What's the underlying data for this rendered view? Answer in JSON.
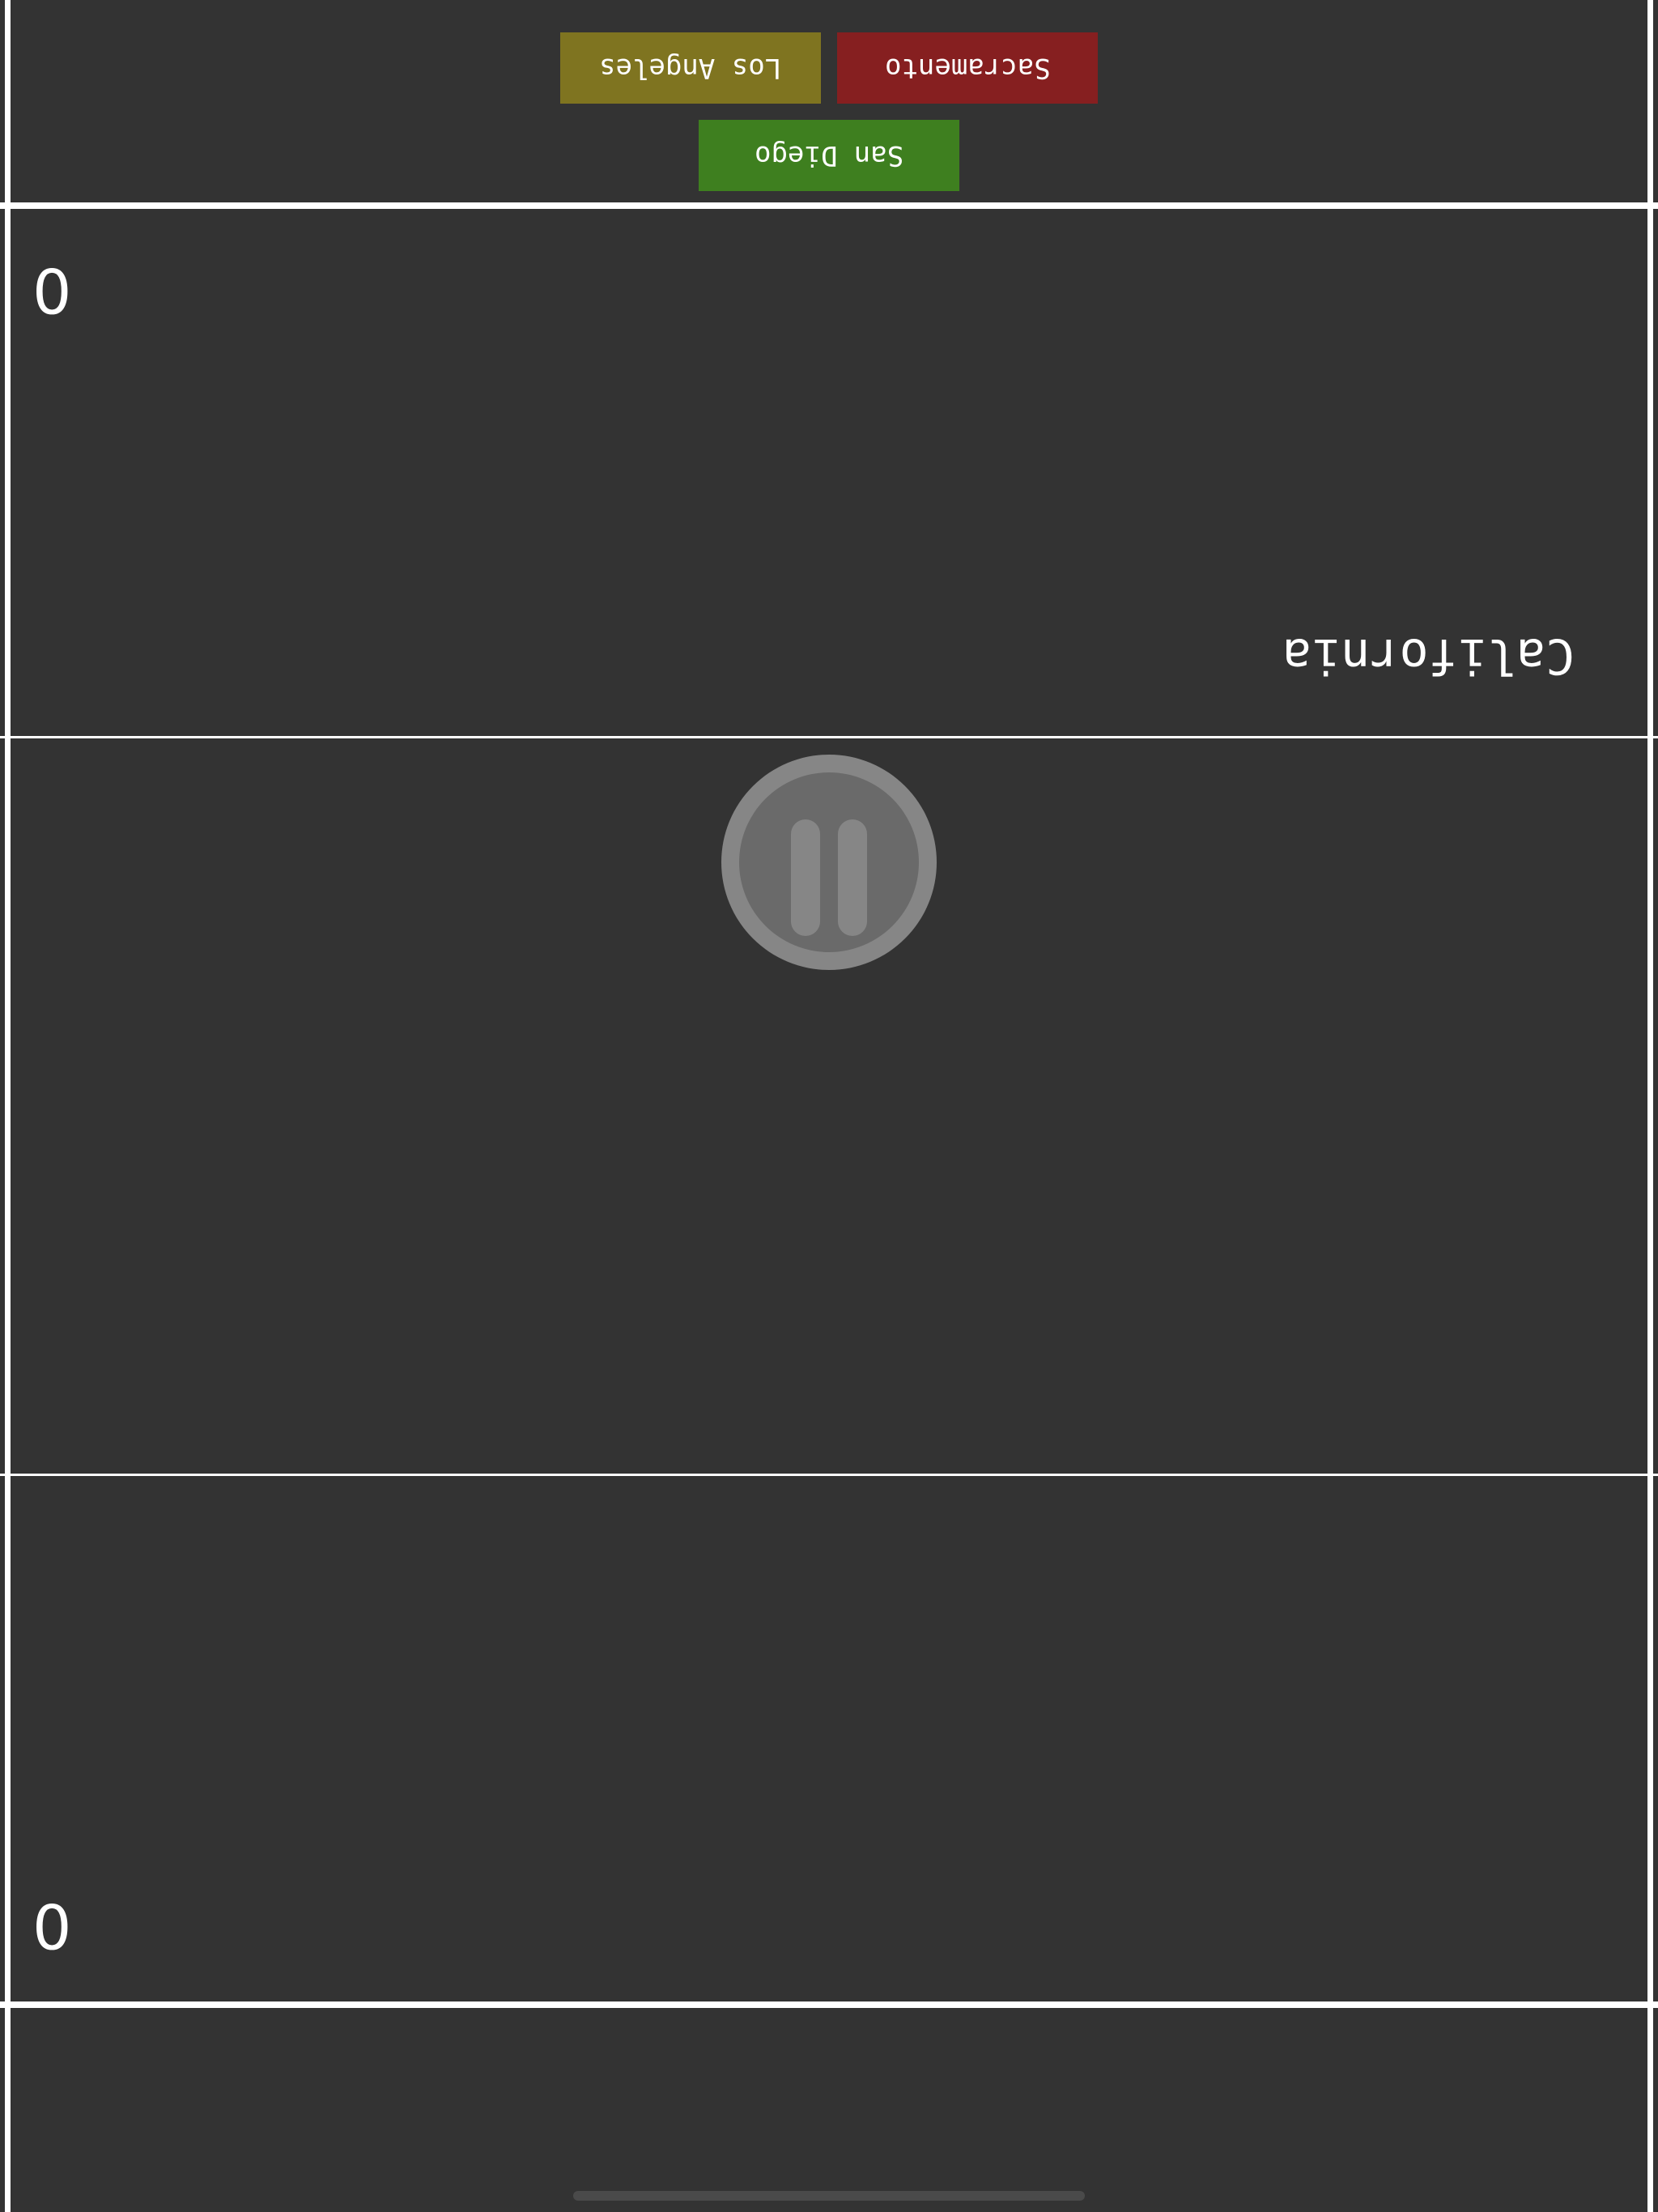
{
  "answers": [
    {
      "label": "Los Angeles",
      "color": "#7f7420"
    },
    {
      "label": "Sacramento",
      "color": "#861f20"
    },
    {
      "label": "San Diego",
      "color": "#3e7f1f"
    }
  ],
  "opponent": {
    "score": "0",
    "prompt": "California"
  },
  "player": {
    "score": "0"
  },
  "colors": {
    "background": "#333333",
    "divider": "#ffffff",
    "pause_outer": "#868686",
    "pause_inner": "#6a6a6a"
  },
  "icons": {
    "pause": "pause-icon"
  }
}
